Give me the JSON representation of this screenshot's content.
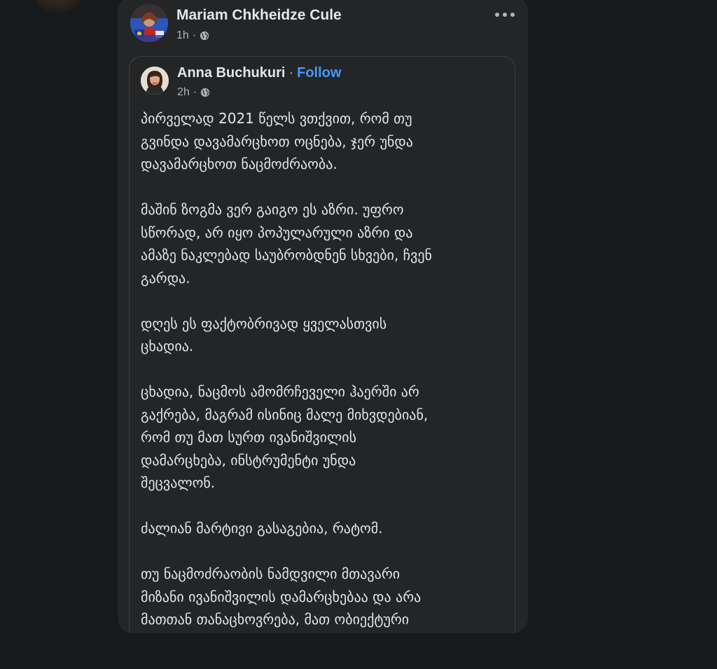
{
  "post": {
    "author": "Mariam Chkheidze Cule",
    "time": "1h",
    "audience_icon": "globe-icon",
    "more_icon": "more-horizontal-icon"
  },
  "shared_post": {
    "author": "Anna Buchukuri",
    "separator": "·",
    "follow_label": "Follow",
    "time": "2h",
    "audience_icon": "globe-icon",
    "paragraphs": [
      "პირველად 2021 წელს ვთქვით, რომ თუ\nგვინდა დავამარცხოთ ოცნება, ჯერ უნდა\nდავამარცხოთ ნაცმოძრაობა.",
      "მაშინ ზოგმა ვერ გაიგო ეს აზრი. უფრო\nსწორად, არ იყო პოპულარული აზრი და\nამაზე ნაკლებად საუბრობდნენ სხვები, ჩვენ\nგარდა.",
      "დღეს ეს ფაქტობრივად ყველასთვის\nცხადია.",
      "ცხადია, ნაცმოს ამომრჩეველი ჰაერში არ\nგაქრება, მაგრამ ისინიც მალე მიხვდებიან,\nრომ თუ მათ სურთ ივანიშვილის\nდამარცხება, ინსტრუმენტი უნდა\nშეცვალონ.",
      "ძალიან მარტივი გასაგებია, რატომ.",
      "თუ ნაცმოძრაობის ნამდვილი მთავარი\nმიზანი ივანიშვილის დამარცხებაა და არა\nმათთან თანაცხოვრება, მათ ობიექტური"
    ]
  },
  "colors": {
    "background": "#18191c",
    "card": "#242526",
    "text_primary": "#e4e6eb",
    "text_secondary": "#b0b3b8",
    "link": "#4599ff"
  }
}
